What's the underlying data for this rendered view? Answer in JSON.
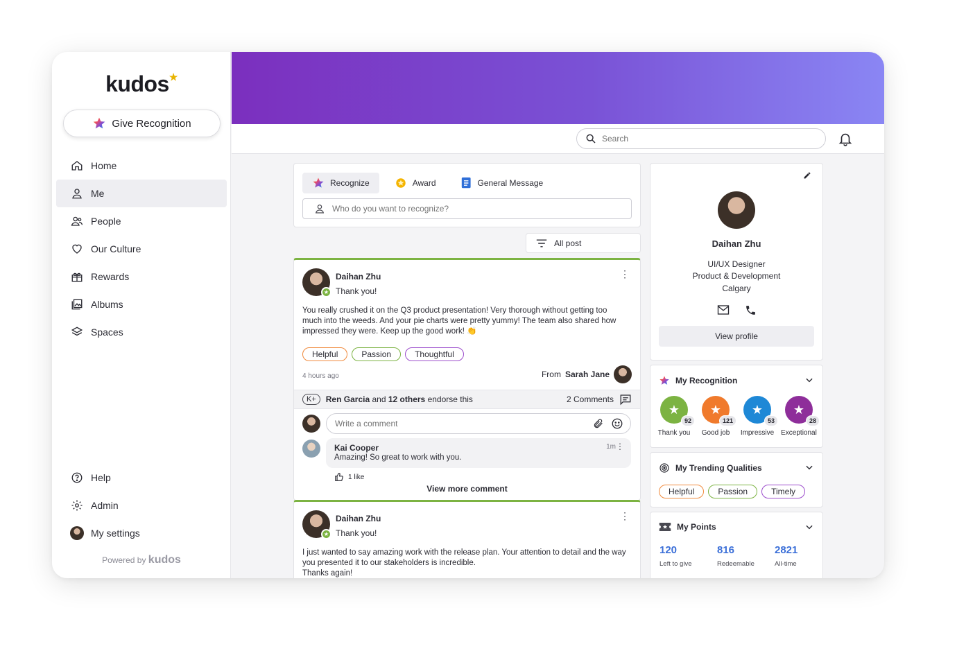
{
  "app": {
    "logo": "kudos",
    "powered_prefix": "Powered by",
    "powered_brand": "kudos"
  },
  "sidebar": {
    "give_label": "Give Recognition",
    "items": [
      {
        "label": "Home",
        "icon": "home-icon"
      },
      {
        "label": "Me",
        "icon": "person-icon"
      },
      {
        "label": "People",
        "icon": "people-icon"
      },
      {
        "label": "Our Culture",
        "icon": "heart-icon"
      },
      {
        "label": "Rewards",
        "icon": "gift-icon"
      },
      {
        "label": "Albums",
        "icon": "album-icon"
      },
      {
        "label": "Spaces",
        "icon": "layers-icon"
      }
    ],
    "bottom": [
      {
        "label": "Help",
        "icon": "help-icon"
      },
      {
        "label": "Admin",
        "icon": "gear-icon"
      },
      {
        "label": "My settings",
        "icon": "avatar"
      }
    ],
    "active": "Me"
  },
  "header": {
    "search_placeholder": "Search"
  },
  "composer": {
    "tabs": [
      "Recognize",
      "Award",
      "General Message"
    ],
    "placeholder": "Who do you want to recognize?"
  },
  "filter": {
    "label": "All post"
  },
  "posts": [
    {
      "author": "Daihan Zhu",
      "title": "Thank you!",
      "body": "You really crushed it on the Q3 product presentation! Very thorough without getting too much into the weeds. And your pie charts were pretty yummy! The team also shared how impressed they were. Keep up the good work! 👏",
      "tags": [
        "Helpful",
        "Passion",
        "Thoughtful"
      ],
      "time": "4 hours ago",
      "from_label": "From",
      "from_name": "Sarah Jane",
      "endorse_kbutton": "K+",
      "endorse_name": "Ren Garcia",
      "endorse_and": "and",
      "endorse_others": "12 others",
      "endorse_suffix": "endorse this",
      "comments": "2 Comments",
      "comment_placeholder": "Write a comment",
      "reply": {
        "name": "Kai Cooper",
        "text": "Amazing! So great to work with you.",
        "time": "1m",
        "likes": "1 like"
      },
      "view_more": "View more comment"
    },
    {
      "author": "Daihan Zhu",
      "title": "Thank you!",
      "body_lines": [
        "I just wanted to say amazing work with the release plan. Your attention to detail and the way you presented it to our stakeholders is incredible.",
        "Thanks again!"
      ]
    }
  ],
  "profile": {
    "name": "Daihan Zhu",
    "role": "UI/UX Designer",
    "dept": "Product & Development",
    "location": "Calgary",
    "view_label": "View profile"
  },
  "my_recognition": {
    "title": "My Recognition",
    "badges": [
      {
        "label": "Thank you",
        "count": "92",
        "color": "#7cb342"
      },
      {
        "label": "Good job",
        "count": "121",
        "color": "#f07a2c"
      },
      {
        "label": "Impressive",
        "count": "53",
        "color": "#1e88d6"
      },
      {
        "label": "Exceptional",
        "count": "28",
        "color": "#8e2e9a"
      }
    ]
  },
  "trending": {
    "title": "My Trending Qualities",
    "tags": [
      "Helpful",
      "Passion",
      "Timely"
    ]
  },
  "points": {
    "title": "My Points",
    "items": [
      {
        "value": "120",
        "label": "Left to give"
      },
      {
        "value": "816",
        "label": "Redeemable"
      },
      {
        "value": "2821",
        "label": "All-time"
      }
    ]
  },
  "colors": {
    "banner_start": "#7b2fbe",
    "banner_end": "#8a86f4",
    "accent_green": "#7cb342",
    "points_blue": "#3b6fd8"
  }
}
